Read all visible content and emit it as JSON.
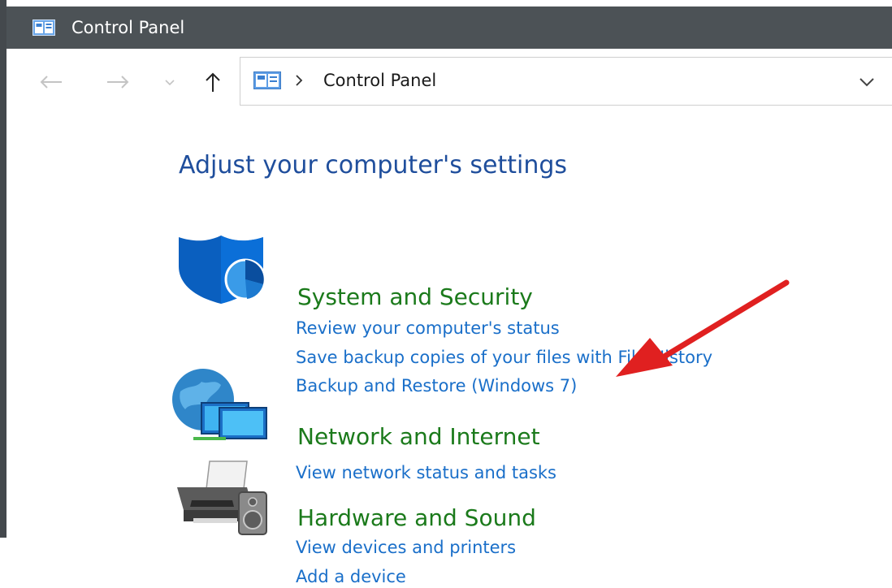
{
  "window": {
    "title": "Control Panel"
  },
  "nav": {
    "back_icon": "arrow-left-icon",
    "forward_icon": "arrow-right-icon",
    "recent_icon": "chevron-down-icon",
    "up_icon": "arrow-up-icon"
  },
  "address": {
    "crumb": "Control Panel",
    "dropdown_icon": "chevron-down-icon"
  },
  "main": {
    "heading": "Adjust your computer's settings",
    "categories": [
      {
        "title": "System and Security",
        "icon": "shield-icon",
        "links": [
          "Review your computer's status",
          "Save backup copies of your files with File History",
          "Backup and Restore (Windows 7)"
        ]
      },
      {
        "title": "Network and Internet",
        "icon": "network-globe-icon",
        "links": [
          "View network status and tasks"
        ]
      },
      {
        "title": "Hardware and Sound",
        "icon": "printer-speaker-icon",
        "links": [
          "View devices and printers",
          "Add a device"
        ]
      }
    ]
  },
  "annotation": {
    "arrow_color": "#e02020"
  },
  "colors": {
    "titlebar": "#4c5256",
    "heading": "#1f4e9c",
    "category_title": "#1b7a1b",
    "link": "#1a6fc9"
  }
}
